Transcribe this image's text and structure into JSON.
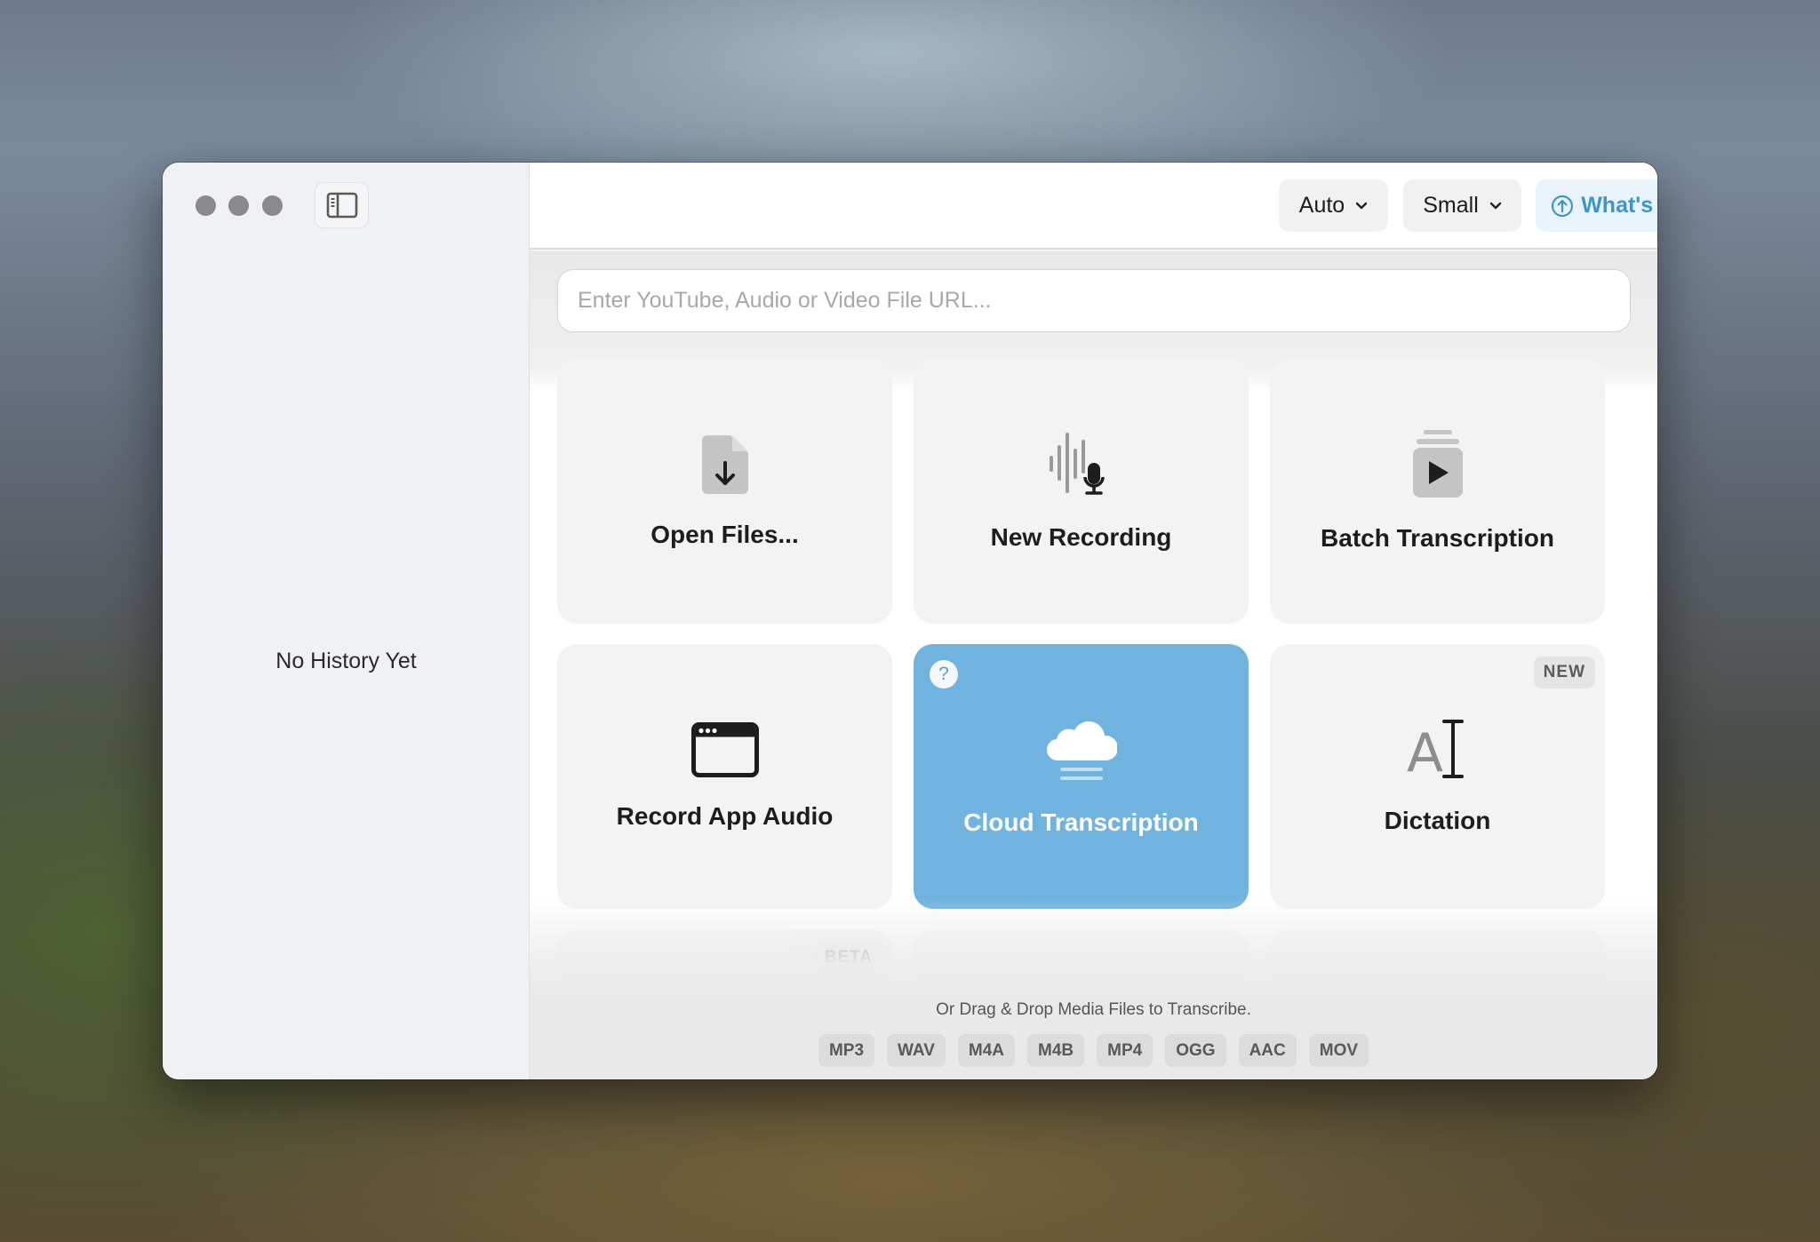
{
  "window": {
    "traffic_lights": [
      "close",
      "minimize",
      "zoom"
    ],
    "sidebar_toggle_icon": "sidebar-left-icon"
  },
  "sidebar": {
    "empty_text": "No History Yet"
  },
  "header": {
    "language_select": {
      "value": "Auto",
      "icon": "chevron-down-icon"
    },
    "model_select": {
      "value": "Small",
      "icon": "chevron-down-icon"
    },
    "whats_new": {
      "label": "What's New?",
      "icon": "arrow-up-circle-icon",
      "color": "#3d96c8"
    },
    "settings_icon": "gear-icon"
  },
  "url_input": {
    "value": "",
    "placeholder": "Enter YouTube, Audio or Video File URL..."
  },
  "cards": [
    {
      "label": "Open Files...",
      "icon": "document-download-icon"
    },
    {
      "label": "New Recording",
      "icon": "waveform-microphone-icon"
    },
    {
      "label": "Batch Transcription",
      "icon": "stack-play-icon"
    },
    {
      "label": "Record App Audio",
      "icon": "app-window-icon"
    },
    {
      "label": "Cloud Transcription",
      "icon": "cloud-icon",
      "help": "?",
      "highlighted": true,
      "color": "#6fb3de"
    },
    {
      "label": "Dictation",
      "icon": "text-cursor-icon",
      "badge": "NEW"
    },
    {
      "label": "",
      "badge": "BETA"
    },
    {
      "label": ""
    },
    {
      "label": ""
    }
  ],
  "footer": {
    "drop_text": "Or Drag & Drop Media Files to Transcribe.",
    "formats": [
      "MP3",
      "WAV",
      "M4A",
      "M4B",
      "MP4",
      "OGG",
      "AAC",
      "MOV"
    ]
  },
  "dictation_icon_text": "A"
}
